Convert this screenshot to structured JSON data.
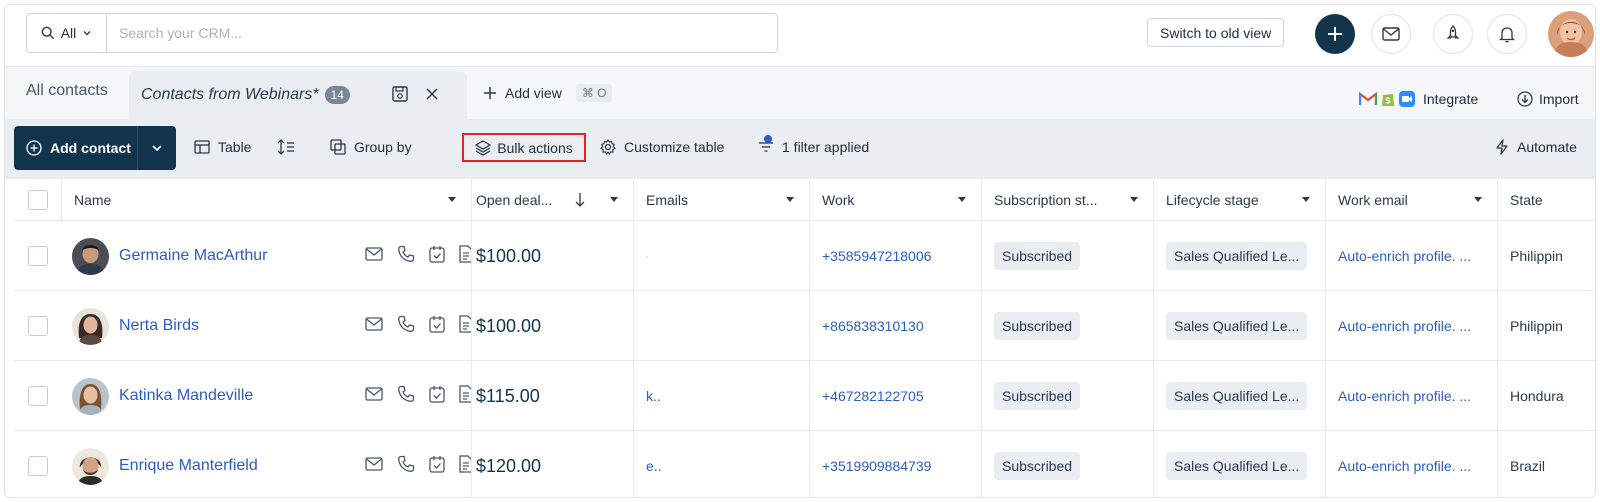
{
  "search": {
    "scope": "All",
    "placeholder": "Search your CRM..."
  },
  "header": {
    "switch_view_label": "Switch to old view"
  },
  "tabs": {
    "all_contacts": "All contacts",
    "active": "Contacts from Webinars*",
    "active_count": "14",
    "add_view": "Add view",
    "add_view_shortcut": "⌘ O",
    "integrate": "Integrate",
    "import": "Import"
  },
  "toolbar": {
    "add_contact": "Add contact",
    "table": "Table",
    "group_by": "Group by",
    "bulk_actions": "Bulk actions",
    "customize_table": "Customize table",
    "filter": "1 filter applied",
    "automate": "Automate"
  },
  "table": {
    "columns": [
      "Name",
      "Open deal...",
      "Emails",
      "Work",
      "Subscription st...",
      "Lifecycle stage",
      "Work email",
      "State"
    ],
    "rows": [
      {
        "name": "Germaine MacArthur",
        "deal": "$100.00",
        "email": "·",
        "work": "+3585947218006",
        "subscription": "Subscribed",
        "lifecycle": "Sales Qualified Le...",
        "work_email": "Auto-enrich profile. ...",
        "state": "Philippin"
      },
      {
        "name": "Nerta Birds",
        "deal": "$100.00",
        "email": "",
        "work": "+865838310130",
        "subscription": "Subscribed",
        "lifecycle": "Sales Qualified Le...",
        "work_email": "Auto-enrich profile. ...",
        "state": "Philippin"
      },
      {
        "name": "Katinka Mandeville",
        "deal": "$115.00",
        "email": "k..",
        "work": "+467282122705",
        "subscription": "Subscribed",
        "lifecycle": "Sales Qualified Le...",
        "work_email": "Auto-enrich profile. ...",
        "state": "Hondura"
      },
      {
        "name": "Enrique Manterfield",
        "deal": "$120.00",
        "email": "e..",
        "work": "+3519909884739",
        "subscription": "Subscribed",
        "lifecycle": "Sales Qualified Le...",
        "work_email": "Auto-enrich profile. ...",
        "state": "Brazil"
      }
    ]
  },
  "colors": {
    "brand_navy": "#12344d",
    "link_blue": "#2c5cc5",
    "highlight_red": "#e02424"
  }
}
